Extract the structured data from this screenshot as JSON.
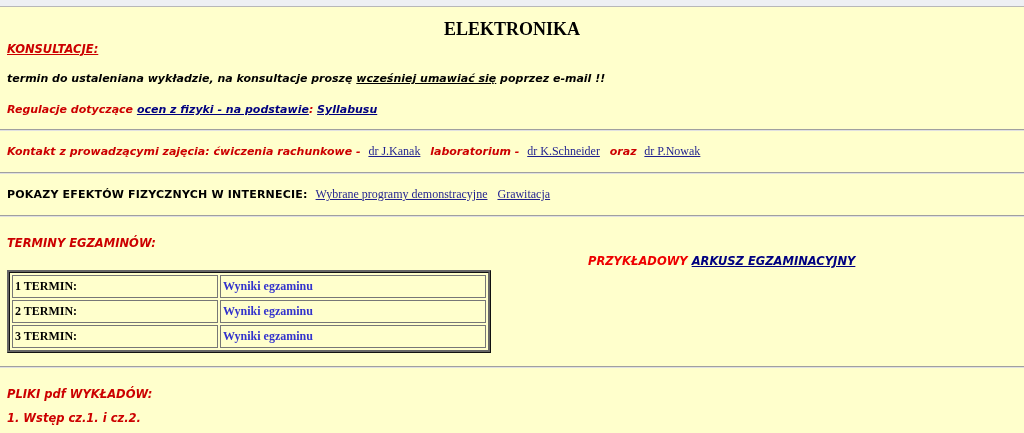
{
  "title": "ELEKTRONIKA",
  "blocks": [
    {
      "kind": "heading",
      "color": "#cc0000",
      "underlined": true,
      "text": "KONSULTACJE:"
    },
    {
      "kind": "paragraph",
      "color": "#000000",
      "segments": [
        {
          "kind": "text",
          "text": "termin do ustaleniana wykładzie, na konsultacje proszę "
        },
        {
          "kind": "underline",
          "text": "wcześniej umawiać się"
        },
        {
          "kind": "text",
          "text": " poprzez e-mail !!"
        }
      ]
    },
    {
      "kind": "paragraph",
      "color": "#cc0000",
      "segments": [
        {
          "kind": "text",
          "text": "Regulacje dotyczące "
        },
        {
          "kind": "link",
          "text": "ocen z fizyki - na podstawie"
        },
        {
          "kind": "text",
          "text": ": "
        },
        {
          "kind": "link",
          "text": "Syllabusu"
        }
      ]
    },
    {
      "kind": "rule"
    },
    {
      "kind": "paragraph",
      "color": "#cc0000",
      "segments": [
        {
          "kind": "text",
          "text": "Kontakt z prowadzącymi zajęcia: ćwiczenia rachunkowe - "
        },
        {
          "kind": "serif-link",
          "text": "dr J.Kanak"
        },
        {
          "kind": "text",
          "text": " laboratorium - "
        },
        {
          "kind": "serif-link",
          "text": "dr K.Schneider"
        },
        {
          "kind": "text",
          "text": " oraz "
        },
        {
          "kind": "serif-link",
          "text": "dr P.Nowak"
        }
      ]
    },
    {
      "kind": "rule"
    },
    {
      "kind": "paragraph",
      "color": "#000000",
      "segments": [
        {
          "kind": "caps",
          "text": "POKAZY EFEKTÓW FIZYCZNYCH W INTERNECIE: "
        },
        {
          "kind": "serif-link",
          "text": "Wybrane programy demonstracyjne"
        },
        {
          "kind": "serif-link",
          "text": "Grawitacja"
        }
      ]
    },
    {
      "kind": "rule"
    },
    {
      "kind": "heading",
      "color": "#cc0000",
      "underlined": false,
      "text": "TERMINY EGZAMINÓW:"
    },
    {
      "kind": "exams",
      "sample": {
        "label": "PRZYKŁADOWY",
        "link": "ARKUSZ EGZAMINACYJNY"
      },
      "rows": [
        {
          "term": "1 TERMIN:",
          "result": "Wyniki egzaminu"
        },
        {
          "term": "2 TERMIN:",
          "result": "Wyniki egzaminu"
        },
        {
          "term": "3 TERMIN:",
          "result": "Wyniki egzaminu"
        }
      ]
    },
    {
      "kind": "rule"
    },
    {
      "kind": "heading",
      "color": "#cc0000",
      "underlined": false,
      "text": "PLIKI pdf WYKŁADÓW:"
    },
    {
      "kind": "heading",
      "color": "#cc0000",
      "underlined": false,
      "text": "1. Wstęp cz.1.  i cz.2."
    }
  ]
}
